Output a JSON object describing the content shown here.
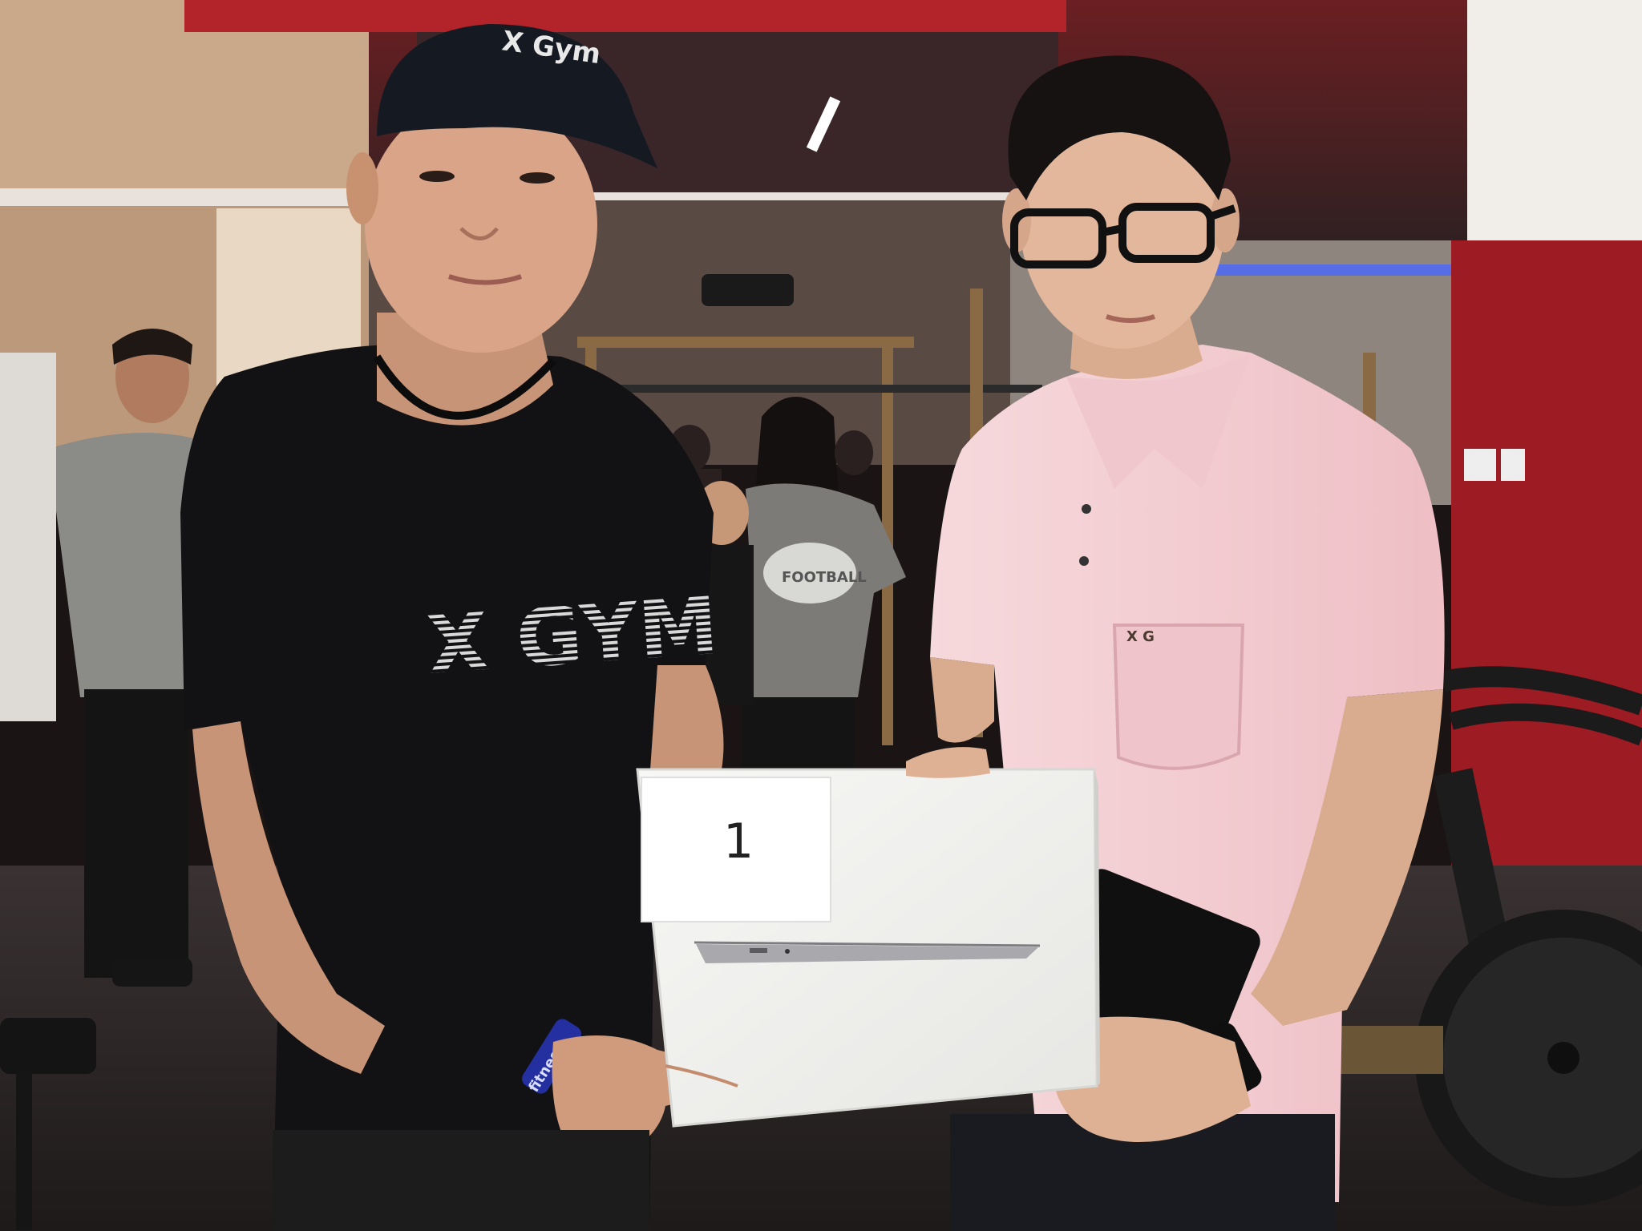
{
  "photo": {
    "cap_text": "X Gym",
    "shirt_text": "X GYM",
    "polo_text": "X G",
    "box_number": "1",
    "wristband_text": "fitness",
    "gray_shirt_text": "FOOTBALL"
  },
  "colors": {
    "ceiling_red": "#b3232a",
    "wall_red": "#9d1b22",
    "black_shirt": "#121214",
    "pink_polo": "#f4cfd3",
    "white_box": "#f1f1ef",
    "floor": "#2a2525"
  }
}
